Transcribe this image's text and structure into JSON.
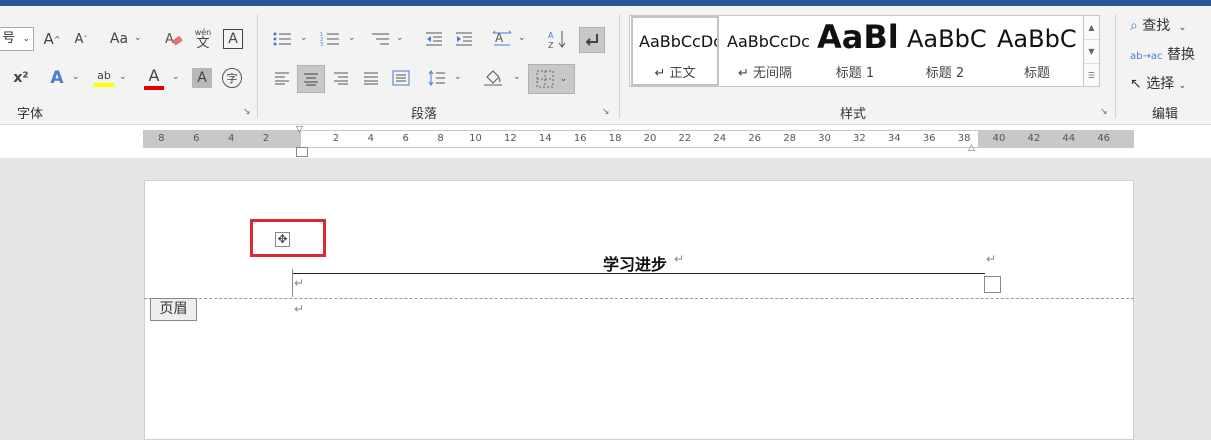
{
  "ribbon": {
    "font_group": {
      "label": "字体",
      "font_size_value": "号",
      "font_size_arrow": "⌄",
      "grow_font": "A",
      "shrink_font": "A",
      "change_case": "Aa",
      "clear_format": "A",
      "pinyin_top": "wén",
      "pinyin_bottom": "文",
      "char_border": "A",
      "superscript": "x²",
      "text_effect": "A",
      "highlight": "ab",
      "font_color": "A",
      "char_shading": "A",
      "enclose_char": "字"
    },
    "paragraph_group": {
      "label": "段落"
    },
    "styles_group": {
      "label": "样式",
      "items": [
        {
          "sample": "AaBbCcDc",
          "name": "↵ 正文"
        },
        {
          "sample": "AaBbCcDc",
          "name": "↵ 无间隔"
        },
        {
          "sample": "AaBl",
          "name": "标题 1"
        },
        {
          "sample": "AaBbC",
          "name": "标题 2"
        },
        {
          "sample": "AaBbC",
          "name": "标题"
        }
      ]
    },
    "editing_group": {
      "label": "编辑",
      "find": "查找",
      "replace": "替换",
      "select": "选择"
    }
  },
  "ruler": {
    "labels": [
      "8",
      "6",
      "4",
      "2",
      "",
      "2",
      "4",
      "6",
      "8",
      "10",
      "12",
      "14",
      "16",
      "18",
      "20",
      "22",
      "24",
      "26",
      "28",
      "30",
      "32",
      "34",
      "36",
      "38",
      "40",
      "42",
      "44",
      "46"
    ]
  },
  "document": {
    "header_title": "学习进步",
    "paragraph_mark": "↵",
    "header_tag": "页眉",
    "move_handle_glyph": "✥"
  },
  "colors": {
    "title_bar": "#2b579a",
    "highlight_box": "#d9292c",
    "highlight_yellow": "#ffff00",
    "font_color_red": "#e00000"
  }
}
